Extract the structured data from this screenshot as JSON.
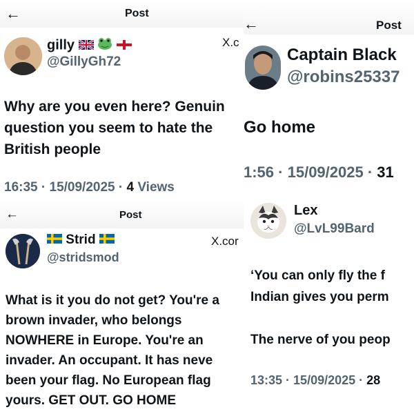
{
  "panel1": {
    "post_title": "Post",
    "name": "gilly",
    "name_emojis": [
      "uk-flag-icon",
      "frog-icon",
      "england-flag-icon"
    ],
    "handle": "@GillyGh72",
    "site_label": "X.c",
    "body_lines": [
      "Why are you even here? Genuin",
      "question you seem to hate the",
      "British people"
    ],
    "time": "16:35",
    "date": "15/09/2025",
    "views_count": "4",
    "views_label": "Views"
  },
  "panel2": {
    "post_title": "Post",
    "name": "Captain Black",
    "handle": "@robins25337",
    "body_lines": [
      "Go home"
    ],
    "time": "1:56",
    "date": "15/09/2025",
    "views_partial": "31"
  },
  "panel3": {
    "post_title": "Post",
    "name": "Strid",
    "name_emojis": [
      "sweden-flag-icon",
      "sweden-flag-icon"
    ],
    "handle": "@stridsmod",
    "site_label": "X.cor",
    "body_lines": [
      "What is it you do not get? You're a",
      "brown invader, who belongs",
      "NOWHERE in Europe. You're an",
      "invader. An occupant. It has neve",
      "been your flag. No European flag",
      "yours. GET OUT. GO HOME"
    ]
  },
  "panel4": {
    "name": "Lex",
    "handle": "@LvL99Bard",
    "body_lines": [
      "‘You can only fly the f",
      "Indian gives you perm",
      "",
      "The nerve of you peop"
    ],
    "time": "13:35",
    "date": "15/09/2025",
    "views_partial": "28"
  },
  "colors": {
    "text": "#0f1419",
    "secondary": "#536471",
    "background": "#ffffff"
  }
}
